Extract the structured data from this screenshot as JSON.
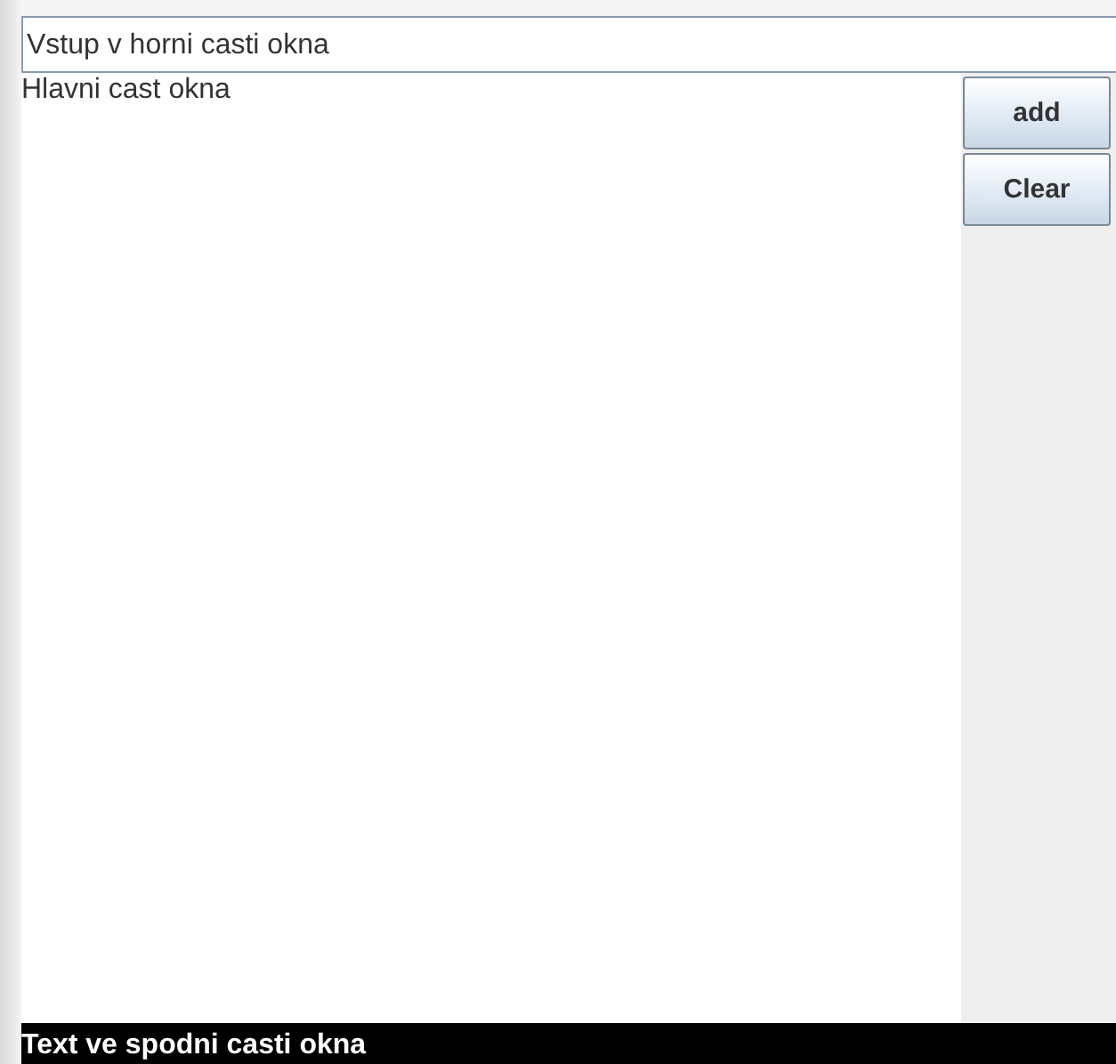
{
  "top_input": {
    "value": "Vstup v horni casti okna"
  },
  "main_area": {
    "value": "Hlavni cast okna"
  },
  "buttons": [
    "add",
    "Clear"
  ],
  "status_bar": "Text ve spodni casti okna"
}
